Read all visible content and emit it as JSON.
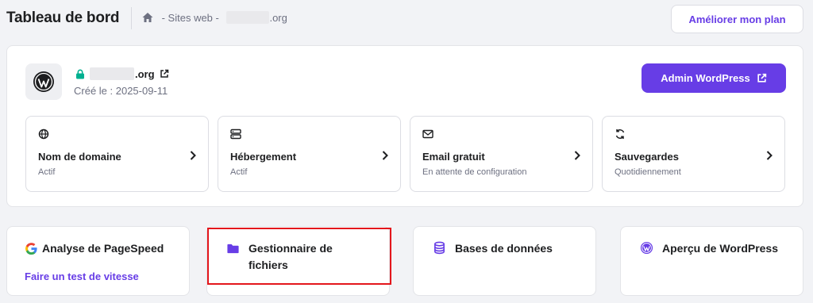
{
  "header": {
    "title": "Tableau de bord",
    "breadcrumb_sites": " - Sites web - ",
    "breadcrumb_domain_suffix": ".org",
    "upgrade_label": "Améliorer mon plan"
  },
  "site": {
    "domain_suffix": ".org",
    "created": "Créé le : 2025-09-11",
    "admin_label": "Admin WordPress"
  },
  "services": [
    {
      "icon": "globe-icon",
      "title": "Nom de domaine",
      "status": "Actif"
    },
    {
      "icon": "server-icon",
      "title": "Hébergement",
      "status": "Actif"
    },
    {
      "icon": "mail-icon",
      "title": "Email gratuit",
      "status": "En attente de configuration"
    },
    {
      "icon": "sync-icon",
      "title": "Sauvegardes",
      "status": "Quotidiennement"
    }
  ],
  "tools": [
    {
      "icon": "google-icon",
      "title": "Analyse de PageSpeed",
      "link": "Faire un test de vitesse"
    },
    {
      "icon": "folder-icon",
      "title_line1": "Gestionnaire de",
      "title_line2": "fichiers"
    },
    {
      "icon": "database-icon",
      "title": "Bases de données"
    },
    {
      "icon": "wordpress-icon",
      "title": "Aperçu de WordPress"
    }
  ],
  "colors": {
    "accent": "#673de6",
    "text": "#1d1e20",
    "muted": "#6d7081",
    "highlight": "#e3161c",
    "lock": "#00b090"
  }
}
